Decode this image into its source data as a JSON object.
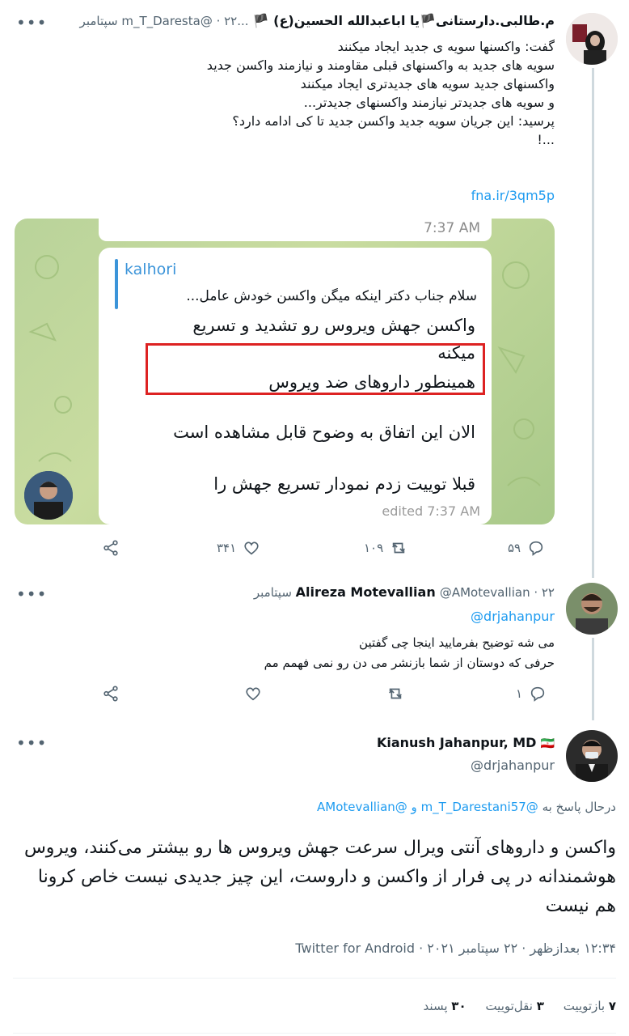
{
  "tweet1": {
    "name": "م.طالبی.دارستانی🏴یا اباعبدالله الحسین(ع) 🏴",
    "handle_date": "...m_T_Daresta@ · ۲۲ سپتامبر",
    "lines": [
      "گفت: واکسنها سویه ی جدید ایجاد میکنند",
      "سویه های جدید به واکسنهای قبلی مقاومند و نیازمند واکسن جدید",
      "واکسنهای جدید سویه های جدیدتری ایجاد میکنند",
      "و سویه های جدیدتر نیازمند واکسنهای جدیدتر...",
      "پرسید: این جریان سویه جدید واکسن جدید تا کی ادامه دارد؟",
      "...!"
    ],
    "link": "fna.ir/3qm5p",
    "image": {
      "top_time": "7:37 AM",
      "quote_author": "kalhori",
      "quote_text": "سلام جناب دکتر اینکه میگن واکسن خودش عامل...",
      "highlight_line1": "واکسن جهش ویروس رو تشدید و تسریع",
      "highlight_line2": "میکنه",
      "line3": "همینطور داروهای ضد ویروس",
      "line4": "الان این اتفاق به وضوح قابل مشاهده است",
      "line5": "قبلا توییت زدم نمودار تسریع جهش را",
      "edited": "edited 7:37 AM"
    },
    "replies": "۵۹",
    "retweets": "۱۰۹",
    "likes": "۳۴۱"
  },
  "tweet2": {
    "name": "Alireza Motevallian",
    "handle_date": "@AMotevallian · ۲۲ سپتامبر",
    "mention": "@drjahanpur",
    "lines": [
      "می شه توضیح بفرمایید اینجا چی گفتین",
      "حرفی که دوستان از شما بازنشر می دن رو نمی فهمم مم"
    ],
    "replies": "۱"
  },
  "main": {
    "name": "Kianush Jahanpur, MD",
    "flag": "🇮🇷",
    "handle": "@drjahanpur",
    "reply_prefix": "درحال پاسخ به",
    "reply_to": "@m_T_Darestani57 و @AMotevallian",
    "text": "واکسن و داروهای آنتی ویرال سرعت جهش ویروس ها رو بیشتر می‌کنند، ویروس هوشمندانه در پی فرار از واکسن و داروست، این چیز جدیدی نیست خاص کرونا هم نیست",
    "meta": "۱۲:۳۴ بعدازظهر · ۲۲ سپتامبر ۲۰۲۱ · Twitter for Android",
    "stats": [
      {
        "count": "۷",
        "label": "بازتوییت"
      },
      {
        "count": "۳",
        "label": "نقل‌توییت"
      },
      {
        "count": "۳۰",
        "label": "پسند"
      }
    ]
  }
}
